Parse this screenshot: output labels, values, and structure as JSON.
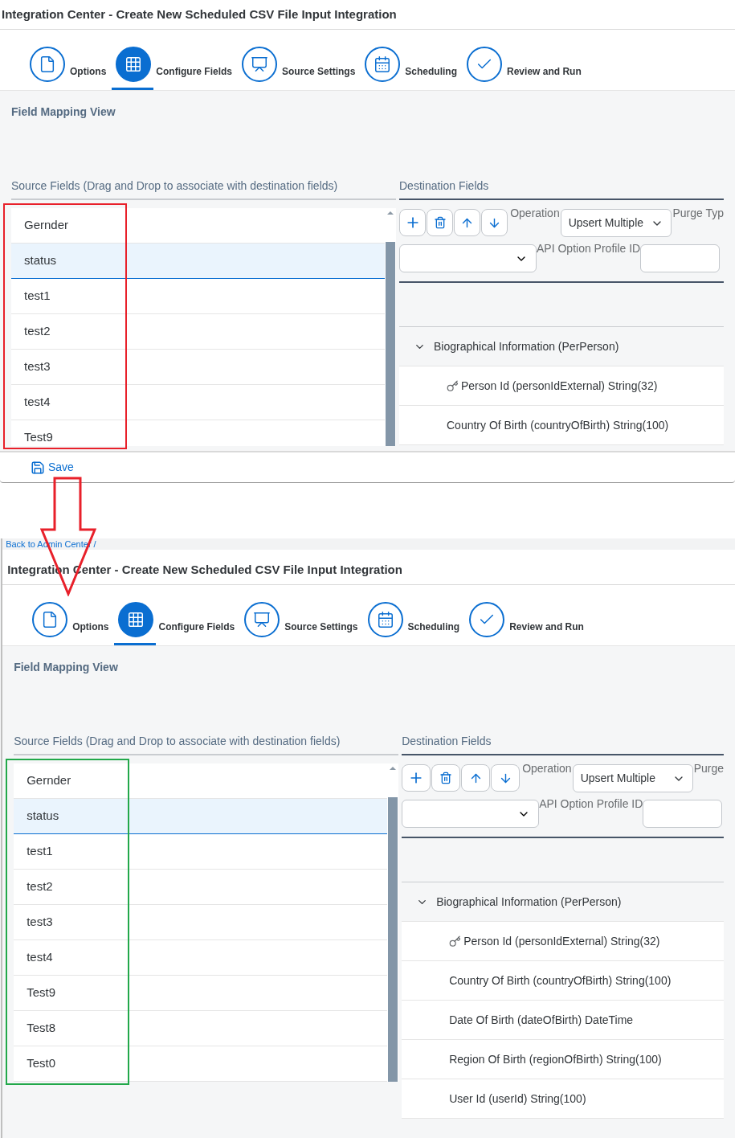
{
  "screens": [
    {
      "title": "Integration Center - Create New Scheduled CSV File Input Integration",
      "steps": [
        {
          "label": "Options",
          "selected": false
        },
        {
          "label": "Configure Fields",
          "selected": true
        },
        {
          "label": "Source Settings",
          "selected": false
        },
        {
          "label": "Scheduling",
          "selected": false
        },
        {
          "label": "Review and Run",
          "selected": false
        }
      ],
      "section_title": "Field Mapping View",
      "source_header": "Source Fields (Drag and Drop to associate with destination fields)",
      "source_fields": [
        {
          "label": "Gernder",
          "selected": false
        },
        {
          "label": "status",
          "selected": true
        },
        {
          "label": "test1",
          "selected": false
        },
        {
          "label": "test2",
          "selected": false
        },
        {
          "label": "test3",
          "selected": false
        },
        {
          "label": "test4",
          "selected": false
        },
        {
          "label": "Test9",
          "selected": false
        }
      ],
      "highlight": {
        "color": "#e8202a"
      },
      "destination_header": "Destination Fields",
      "operation_label": "Operation",
      "operation_value": "Upsert Multiple",
      "purge_label": "Purge Typ",
      "api_label": "API Option Profile ID",
      "destination_tree": [
        {
          "label": "Biographical Information (PerPerson)",
          "expanded": true,
          "children": [
            {
              "label": "Person Id (personIdExternal) String(32)",
              "kind": "key"
            },
            {
              "label": "Country Of Birth (countryOfBirth) String(100)",
              "kind": "field"
            }
          ]
        }
      ],
      "save_button": "Save"
    },
    {
      "breadcrumb": "Back to Admin Center /",
      "title": "Integration Center - Create New Scheduled CSV File Input Integration",
      "steps": [
        {
          "label": "Options",
          "selected": false
        },
        {
          "label": "Configure Fields",
          "selected": true
        },
        {
          "label": "Source Settings",
          "selected": false
        },
        {
          "label": "Scheduling",
          "selected": false
        },
        {
          "label": "Review and Run",
          "selected": false
        }
      ],
      "section_title": "Field Mapping View",
      "source_header": "Source Fields (Drag and Drop to associate with destination fields)",
      "source_fields": [
        {
          "label": "Gernder",
          "selected": false
        },
        {
          "label": "status",
          "selected": true
        },
        {
          "label": "test1",
          "selected": false
        },
        {
          "label": "test2",
          "selected": false
        },
        {
          "label": "test3",
          "selected": false
        },
        {
          "label": "test4",
          "selected": false
        },
        {
          "label": "Test9",
          "selected": false
        },
        {
          "label": "Test8",
          "selected": false
        },
        {
          "label": "Test0",
          "selected": false
        }
      ],
      "highlight": {
        "color": "#22a84a"
      },
      "destination_header": "Destination Fields",
      "operation_label": "Operation",
      "operation_value": "Upsert Multiple",
      "purge_label": "Purge",
      "api_label": "API Option Profile ID",
      "destination_tree": [
        {
          "label": "Biographical Information (PerPerson)",
          "expanded": true,
          "children": [
            {
              "label": "Person Id (personIdExternal) String(32)",
              "kind": "key"
            },
            {
              "label": "Country Of Birth (countryOfBirth) String(100)",
              "kind": "field"
            },
            {
              "label": "Date Of Birth (dateOfBirth) DateTime",
              "kind": "field"
            },
            {
              "label": "Region Of Birth (regionOfBirth) String(100)",
              "kind": "field"
            },
            {
              "label": "User Id (userId) String(100)",
              "kind": "field"
            }
          ]
        }
      ]
    }
  ],
  "arrow": {
    "color": "#e8202a"
  }
}
